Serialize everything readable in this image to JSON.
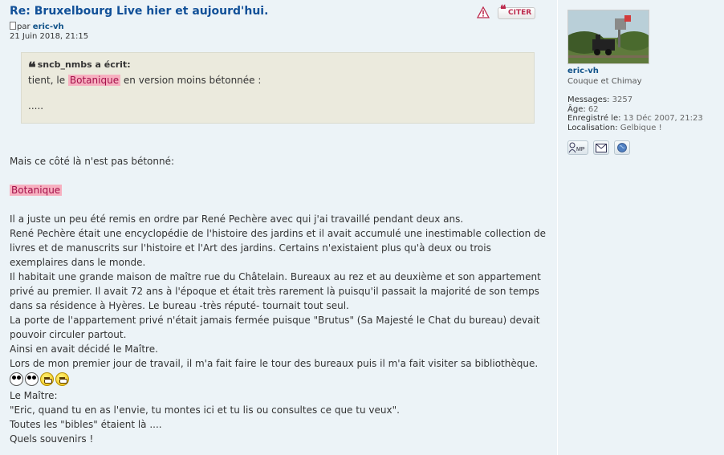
{
  "post": {
    "title": "Re: Bruxelbourg Live hier et aujourd'hui.",
    "by": "par",
    "author": "eric-vh",
    "date": "21 Juin 2018, 21:15"
  },
  "actions": {
    "cite_label": "CITER"
  },
  "quote": {
    "author_line": "sncb_nmbs a écrit:",
    "line1_before": "tient, le",
    "line1_highlight": "Botanique",
    "line1_after": "en version moins bétonnée :",
    "line2": "....."
  },
  "content": {
    "intro": "Mais ce côté là n'est pas bétonné:",
    "highlight": "Botanique",
    "paragraph": [
      "Il a juste un peu été remis en ordre par René Pechère avec qui j'ai travaillé pendant deux ans.",
      "René Pechère était une encyclopédie de l'histoire des jardins et il avait accumulé une inestimable collection de livres et de manuscrits sur l'histoire et l'Art des jardins. Certains n'existaient plus qu'à deux ou trois exemplaires dans le monde.",
      "Il habitait une grande maison de maître rue du Châtelain. Bureaux au rez et au deuxième et son appartement privé au premier. Il avait 72 ans à l'époque et était très rarement là puisqu'il passait la majorité de son temps dans sa résidence à Hyères. Le bureau -très réputé- tournait tout seul.",
      "La porte de l'appartement privé n'était jamais fermée puisque \"Brutus\" (Sa Majesté le Chat du bureau) devait pouvoir circuler partout.",
      "Ainsi en avait décidé le Maître.",
      "Lors de mon premier jour de travail, il m'a fait faire le tour des bureaux puis il m'a fait visiter sa bibliothèque."
    ],
    "after_smilies": [
      "Le Maître:",
      "\"Eric, quand tu en as l'envie, tu montes ici et tu lis ou consultes ce que tu veux\".",
      "Toutes les \"bibles\" étaient là ....",
      "Quels souvenirs !"
    ]
  },
  "profile": {
    "username": "eric-vh",
    "rank": "Couque et Chimay",
    "messages_label": "Messages:",
    "messages_value": "3257",
    "age_label": "Âge:",
    "age_value": "62",
    "registered_label": "Enregistré le:",
    "registered_value": "13 Déc 2007, 21:23",
    "location_label": "Localisation:",
    "location_value": "Gelbique !",
    "pm_label": "MP"
  }
}
